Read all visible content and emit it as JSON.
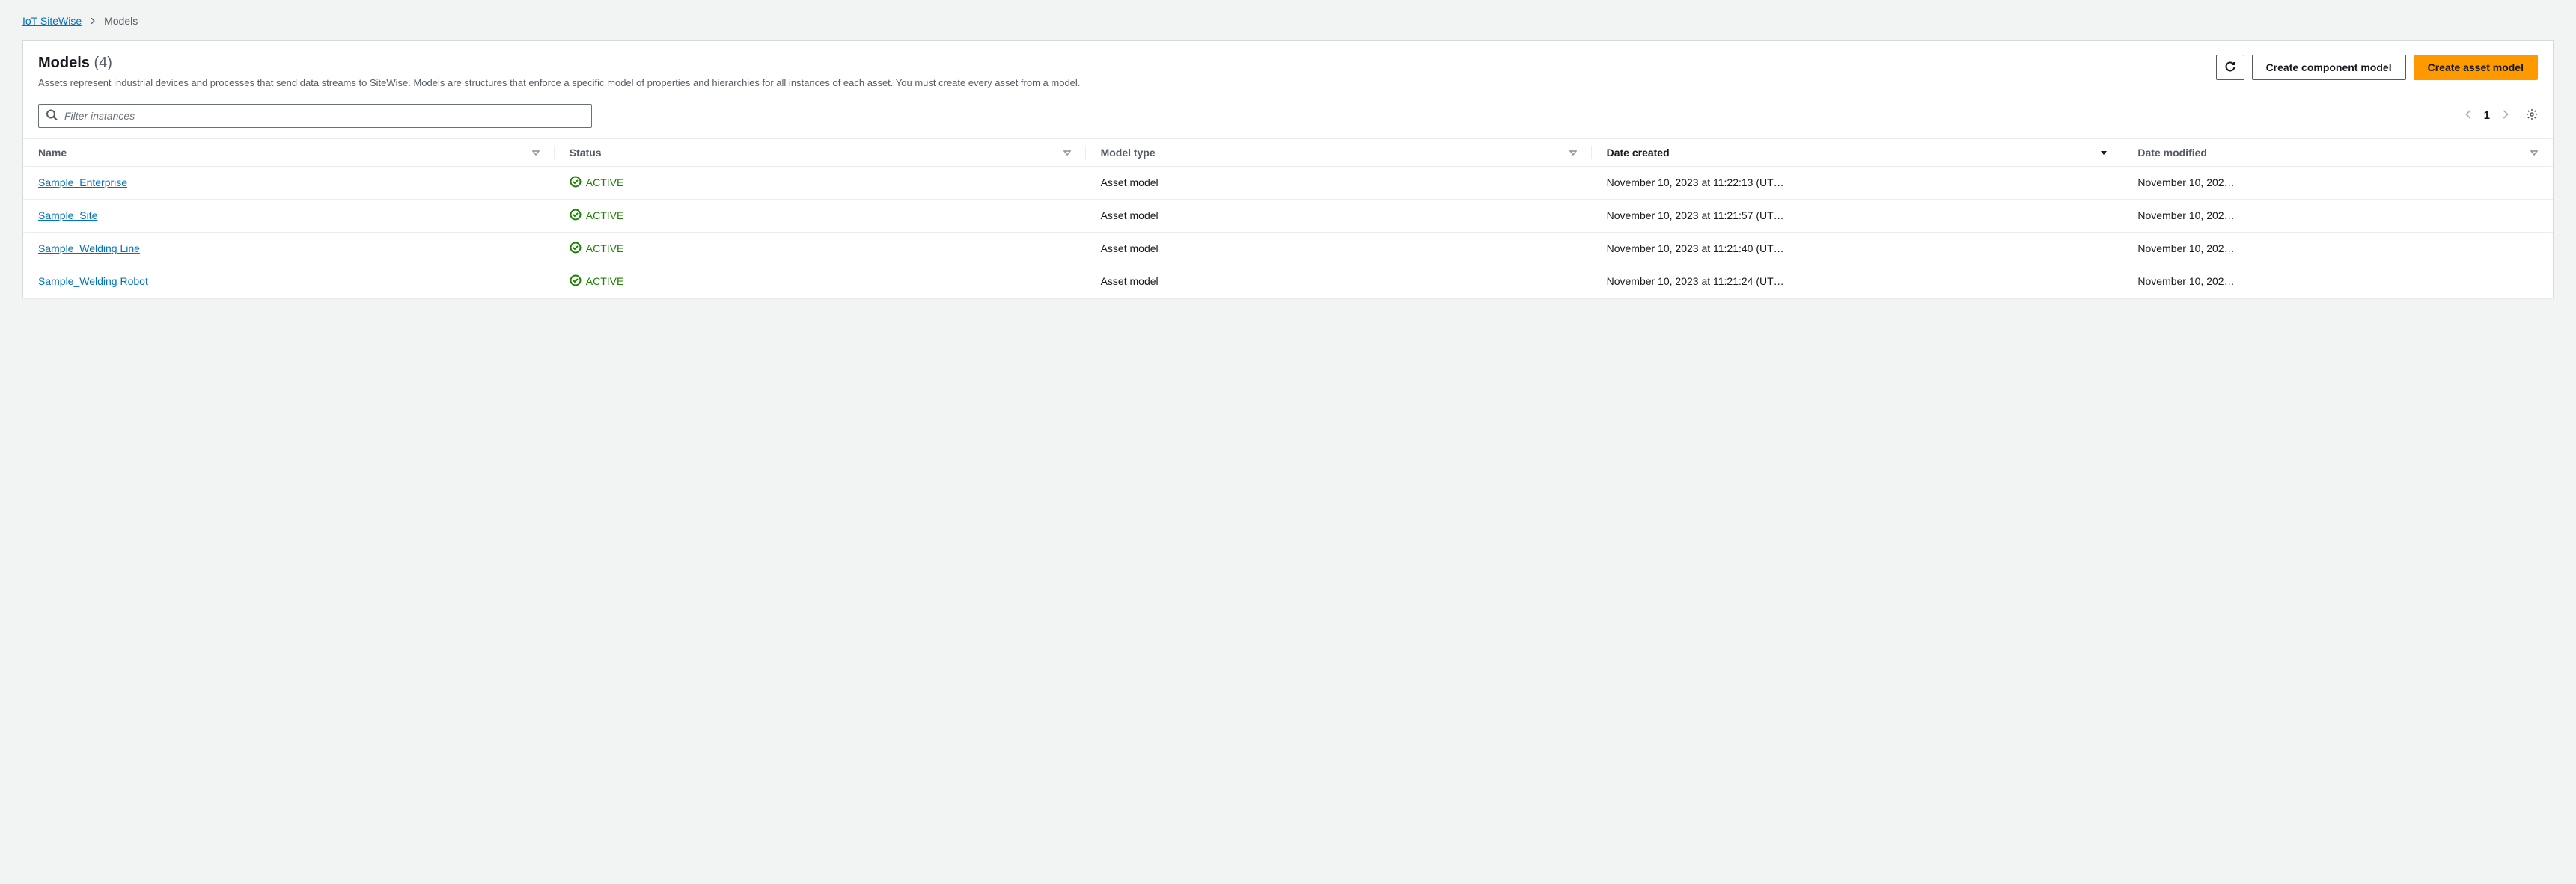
{
  "breadcrumb": {
    "root": "IoT SiteWise",
    "current": "Models"
  },
  "header": {
    "title": "Models",
    "count": "(4)",
    "description": "Assets represent industrial devices and processes that send data streams to SiteWise. Models are structures that enforce a specific model of properties and hierarchies for all instances of each asset. You must create every asset from a model.",
    "refresh_label": "Refresh",
    "create_component_label": "Create component model",
    "create_asset_label": "Create asset model"
  },
  "filter": {
    "placeholder": "Filter instances"
  },
  "pager": {
    "page": "1"
  },
  "columns": {
    "name": "Name",
    "status": "Status",
    "type": "Model type",
    "created": "Date created",
    "modified": "Date modified"
  },
  "rows": [
    {
      "name": "Sample_Enterprise",
      "status": "ACTIVE",
      "type": "Asset model",
      "created": "November 10, 2023 at 11:22:13 (UT…",
      "modified": "November 10, 202…"
    },
    {
      "name": "Sample_Site",
      "status": "ACTIVE",
      "type": "Asset model",
      "created": "November 10, 2023 at 11:21:57 (UT…",
      "modified": "November 10, 202…"
    },
    {
      "name": "Sample_Welding Line",
      "status": "ACTIVE",
      "type": "Asset model",
      "created": "November 10, 2023 at 11:21:40 (UT…",
      "modified": "November 10, 202…"
    },
    {
      "name": "Sample_Welding Robot",
      "status": "ACTIVE",
      "type": "Asset model",
      "created": "November 10, 2023 at 11:21:24 (UT…",
      "modified": "November 10, 202…"
    }
  ]
}
